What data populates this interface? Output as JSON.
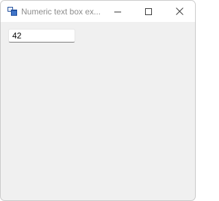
{
  "window": {
    "title": "Numeric text box ex...",
    "controls": {
      "minimize_icon": "minimize-icon",
      "maximize_icon": "maximize-icon",
      "close_icon": "close-icon"
    }
  },
  "form": {
    "numeric_value": "42"
  },
  "colors": {
    "titlebar": "#ffffff",
    "client": "#f0f0f0",
    "title_text": "#8c8c8c",
    "icon_blue": "#1f4e9c"
  }
}
